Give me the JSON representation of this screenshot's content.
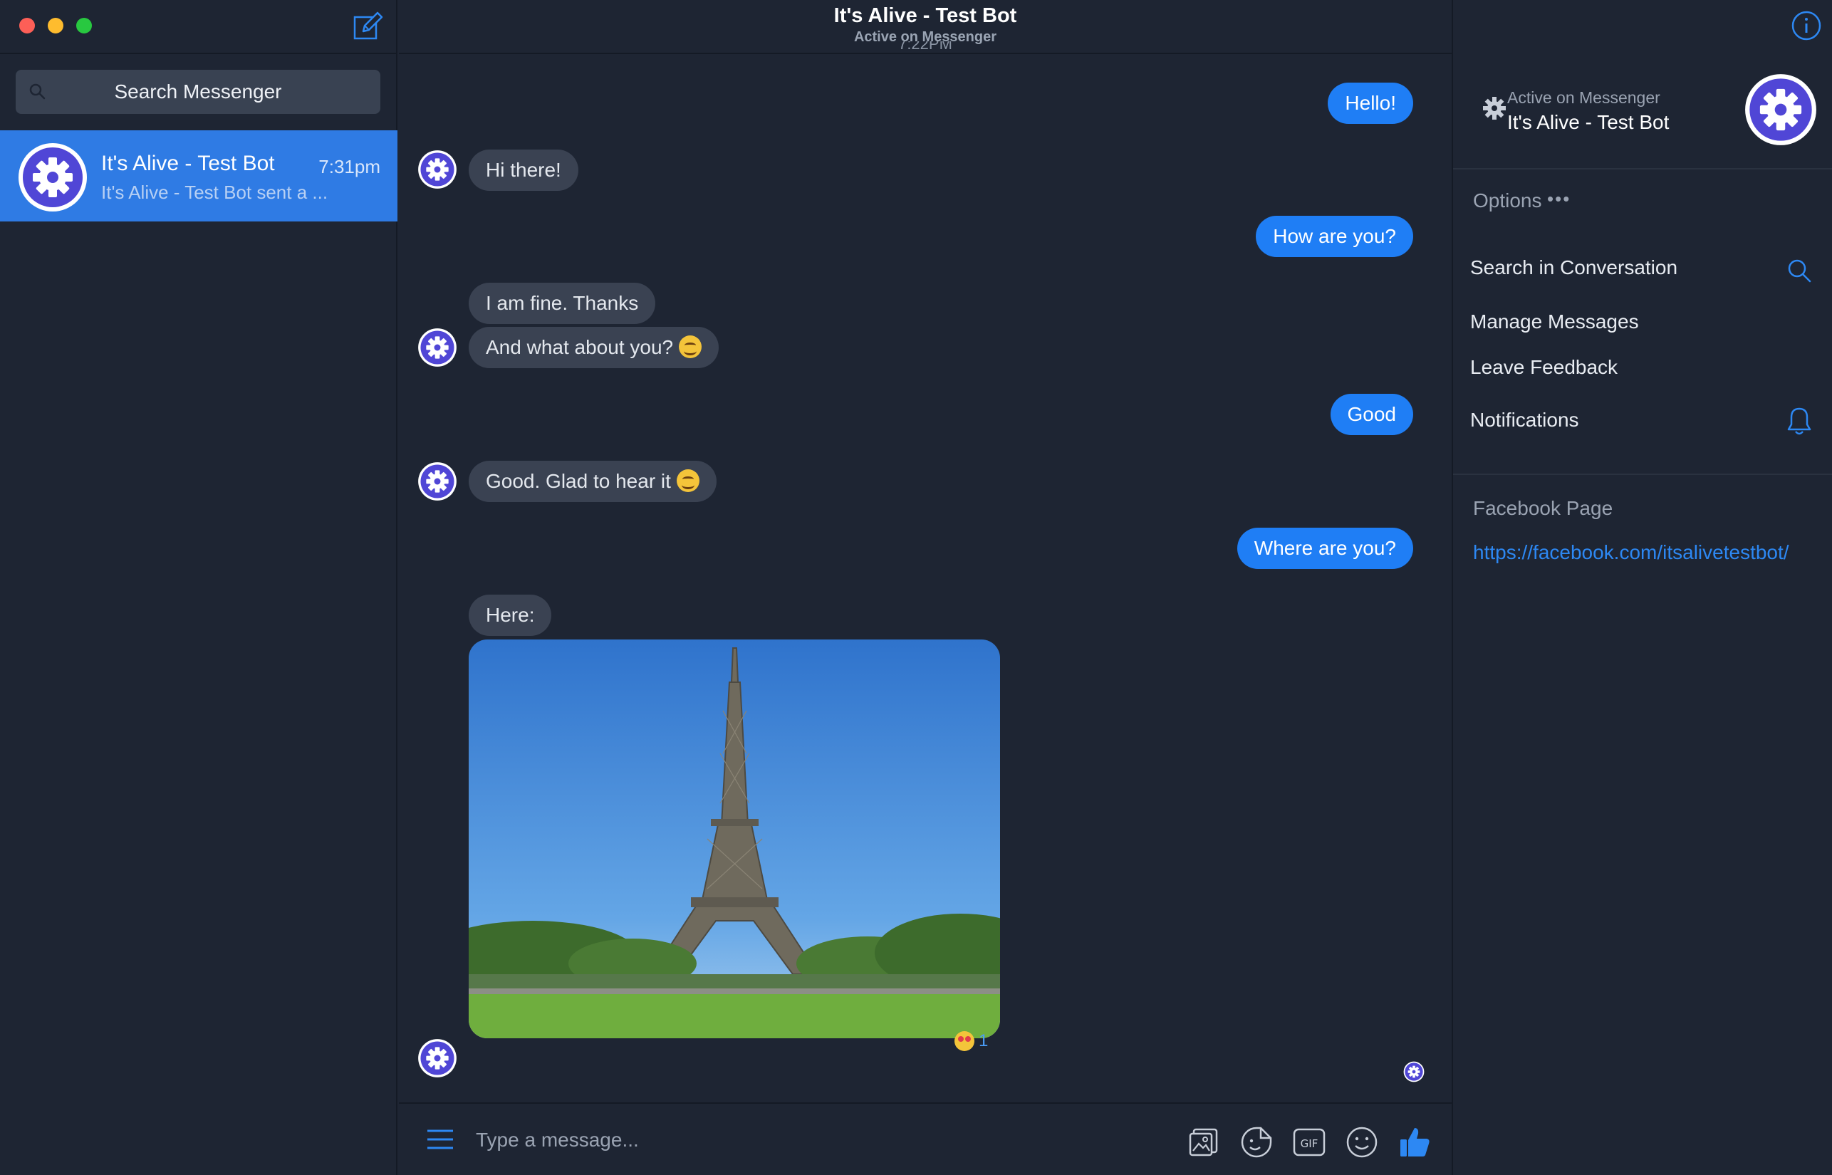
{
  "window": {
    "title": "It's Alive - Test Bot",
    "subtitle": "Active on Messenger"
  },
  "sidebar": {
    "search_placeholder": "Search Messenger",
    "conversations": [
      {
        "name": "It's Alive - Test Bot",
        "time": "7:31pm",
        "snippet": "It's Alive - Test Bot sent a ..."
      }
    ]
  },
  "chat": {
    "timestamp": "7:22PM",
    "messages": [
      {
        "from": "me",
        "text": "Hello!"
      },
      {
        "from": "bot",
        "text": "Hi there!"
      },
      {
        "from": "me",
        "text": "How are you?"
      },
      {
        "from": "bot",
        "text": "I am fine. Thanks"
      },
      {
        "from": "bot",
        "text": "And what about you?"
      },
      {
        "from": "me",
        "text": "Good"
      },
      {
        "from": "bot",
        "text": "Good. Glad to hear it"
      },
      {
        "from": "me",
        "text": "Where are you?"
      },
      {
        "from": "bot",
        "text": "Here:"
      }
    ],
    "photo_reaction": {
      "emoji": "heart-eyes",
      "count": "1"
    },
    "composer_placeholder": "Type a message..."
  },
  "right_panel": {
    "active_label": "Active on Messenger",
    "name": "It's Alive - Test Bot",
    "options_label": "Options",
    "options_dots": "•••",
    "options": [
      "Search in Conversation",
      "Manage Messages",
      "Leave Feedback",
      "Notifications"
    ],
    "facebook_page_label": "Facebook Page",
    "facebook_page_url": "https://facebook.com/itsalivetestbot/"
  },
  "colors": {
    "background": "#1e2533",
    "accent": "#1f7ef5",
    "selected_item": "#2f7be4",
    "bot_avatar": "#5046d6"
  }
}
